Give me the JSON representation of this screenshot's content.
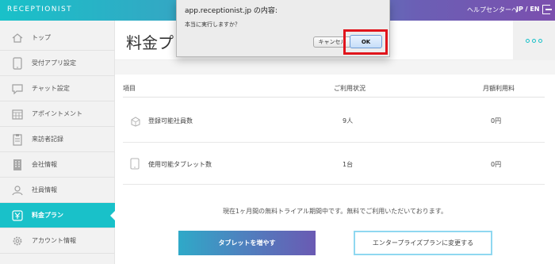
{
  "topbar": {
    "brand": "RECEPTIONIST",
    "help_label": "ヘルプセンターへ",
    "lang_label": "JP / EN",
    "exit_icon": "logout-icon"
  },
  "sidebar": {
    "items": [
      {
        "label": "トップ",
        "icon": "home-icon",
        "active": false
      },
      {
        "label": "受付アプリ設定",
        "icon": "tablet-icon",
        "active": false
      },
      {
        "label": "チャット設定",
        "icon": "chat-icon",
        "active": false
      },
      {
        "label": "アポイントメント",
        "icon": "calendar-icon",
        "active": false
      },
      {
        "label": "来訪者記録",
        "icon": "clipboard-icon",
        "active": false
      },
      {
        "label": "会社情報",
        "icon": "building-icon",
        "active": false
      },
      {
        "label": "社員情報",
        "icon": "employee-icon",
        "active": false
      },
      {
        "label": "料金プラン",
        "icon": "yen-icon",
        "active": true
      },
      {
        "label": "アカウント情報",
        "icon": "gear-icon",
        "active": false
      }
    ]
  },
  "page": {
    "title": "料金プ"
  },
  "table": {
    "headers": {
      "item": "項目",
      "usage": "ご利用状況",
      "fee": "月額利用料"
    },
    "rows": [
      {
        "label": "登録可能社員数",
        "usage": "9人",
        "fee": "0円",
        "icon": "people-icon"
      },
      {
        "label": "使用可能タブレット数",
        "usage": "1台",
        "fee": "0円",
        "icon": "tablet-icon"
      }
    ]
  },
  "notice": "現在1ヶ月間の無料トライアル期間中です。無料でご利用いただいております。",
  "buttons": {
    "add_tablet": "タブレットを増やす",
    "change_plan": "エンタープライズプランに変更する"
  },
  "dialog": {
    "title": "app.receptionist.jp の内容:",
    "message": "本当に実行しますか？",
    "cancel_label": "キャンセル",
    "ok_label": "OK"
  },
  "colors": {
    "accent": "#19c1c9",
    "highlight": "#e0141c"
  }
}
